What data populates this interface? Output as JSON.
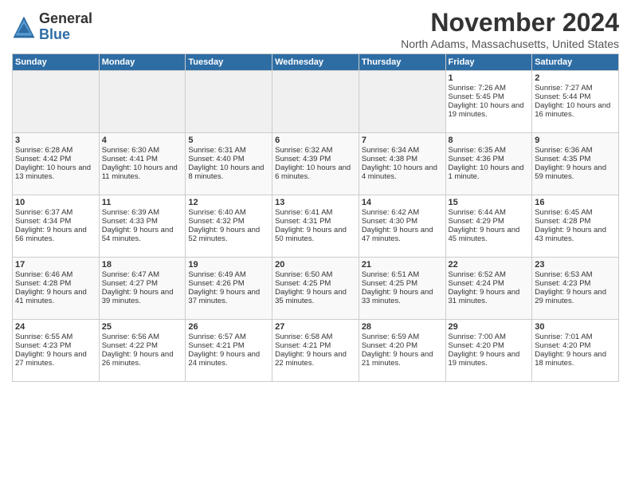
{
  "logo": {
    "general": "General",
    "blue": "Blue"
  },
  "title": "November 2024",
  "location": "North Adams, Massachusetts, United States",
  "days_of_week": [
    "Sunday",
    "Monday",
    "Tuesday",
    "Wednesday",
    "Thursday",
    "Friday",
    "Saturday"
  ],
  "weeks": [
    [
      {
        "day": "",
        "info": ""
      },
      {
        "day": "",
        "info": ""
      },
      {
        "day": "",
        "info": ""
      },
      {
        "day": "",
        "info": ""
      },
      {
        "day": "",
        "info": ""
      },
      {
        "day": "1",
        "info": "Sunrise: 7:26 AM\nSunset: 5:45 PM\nDaylight: 10 hours and 19 minutes."
      },
      {
        "day": "2",
        "info": "Sunrise: 7:27 AM\nSunset: 5:44 PM\nDaylight: 10 hours and 16 minutes."
      }
    ],
    [
      {
        "day": "3",
        "info": "Sunrise: 6:28 AM\nSunset: 4:42 PM\nDaylight: 10 hours and 13 minutes."
      },
      {
        "day": "4",
        "info": "Sunrise: 6:30 AM\nSunset: 4:41 PM\nDaylight: 10 hours and 11 minutes."
      },
      {
        "day": "5",
        "info": "Sunrise: 6:31 AM\nSunset: 4:40 PM\nDaylight: 10 hours and 8 minutes."
      },
      {
        "day": "6",
        "info": "Sunrise: 6:32 AM\nSunset: 4:39 PM\nDaylight: 10 hours and 6 minutes."
      },
      {
        "day": "7",
        "info": "Sunrise: 6:34 AM\nSunset: 4:38 PM\nDaylight: 10 hours and 4 minutes."
      },
      {
        "day": "8",
        "info": "Sunrise: 6:35 AM\nSunset: 4:36 PM\nDaylight: 10 hours and 1 minute."
      },
      {
        "day": "9",
        "info": "Sunrise: 6:36 AM\nSunset: 4:35 PM\nDaylight: 9 hours and 59 minutes."
      }
    ],
    [
      {
        "day": "10",
        "info": "Sunrise: 6:37 AM\nSunset: 4:34 PM\nDaylight: 9 hours and 56 minutes."
      },
      {
        "day": "11",
        "info": "Sunrise: 6:39 AM\nSunset: 4:33 PM\nDaylight: 9 hours and 54 minutes."
      },
      {
        "day": "12",
        "info": "Sunrise: 6:40 AM\nSunset: 4:32 PM\nDaylight: 9 hours and 52 minutes."
      },
      {
        "day": "13",
        "info": "Sunrise: 6:41 AM\nSunset: 4:31 PM\nDaylight: 9 hours and 50 minutes."
      },
      {
        "day": "14",
        "info": "Sunrise: 6:42 AM\nSunset: 4:30 PM\nDaylight: 9 hours and 47 minutes."
      },
      {
        "day": "15",
        "info": "Sunrise: 6:44 AM\nSunset: 4:29 PM\nDaylight: 9 hours and 45 minutes."
      },
      {
        "day": "16",
        "info": "Sunrise: 6:45 AM\nSunset: 4:28 PM\nDaylight: 9 hours and 43 minutes."
      }
    ],
    [
      {
        "day": "17",
        "info": "Sunrise: 6:46 AM\nSunset: 4:28 PM\nDaylight: 9 hours and 41 minutes."
      },
      {
        "day": "18",
        "info": "Sunrise: 6:47 AM\nSunset: 4:27 PM\nDaylight: 9 hours and 39 minutes."
      },
      {
        "day": "19",
        "info": "Sunrise: 6:49 AM\nSunset: 4:26 PM\nDaylight: 9 hours and 37 minutes."
      },
      {
        "day": "20",
        "info": "Sunrise: 6:50 AM\nSunset: 4:25 PM\nDaylight: 9 hours and 35 minutes."
      },
      {
        "day": "21",
        "info": "Sunrise: 6:51 AM\nSunset: 4:25 PM\nDaylight: 9 hours and 33 minutes."
      },
      {
        "day": "22",
        "info": "Sunrise: 6:52 AM\nSunset: 4:24 PM\nDaylight: 9 hours and 31 minutes."
      },
      {
        "day": "23",
        "info": "Sunrise: 6:53 AM\nSunset: 4:23 PM\nDaylight: 9 hours and 29 minutes."
      }
    ],
    [
      {
        "day": "24",
        "info": "Sunrise: 6:55 AM\nSunset: 4:23 PM\nDaylight: 9 hours and 27 minutes."
      },
      {
        "day": "25",
        "info": "Sunrise: 6:56 AM\nSunset: 4:22 PM\nDaylight: 9 hours and 26 minutes."
      },
      {
        "day": "26",
        "info": "Sunrise: 6:57 AM\nSunset: 4:21 PM\nDaylight: 9 hours and 24 minutes."
      },
      {
        "day": "27",
        "info": "Sunrise: 6:58 AM\nSunset: 4:21 PM\nDaylight: 9 hours and 22 minutes."
      },
      {
        "day": "28",
        "info": "Sunrise: 6:59 AM\nSunset: 4:20 PM\nDaylight: 9 hours and 21 minutes."
      },
      {
        "day": "29",
        "info": "Sunrise: 7:00 AM\nSunset: 4:20 PM\nDaylight: 9 hours and 19 minutes."
      },
      {
        "day": "30",
        "info": "Sunrise: 7:01 AM\nSunset: 4:20 PM\nDaylight: 9 hours and 18 minutes."
      }
    ]
  ]
}
